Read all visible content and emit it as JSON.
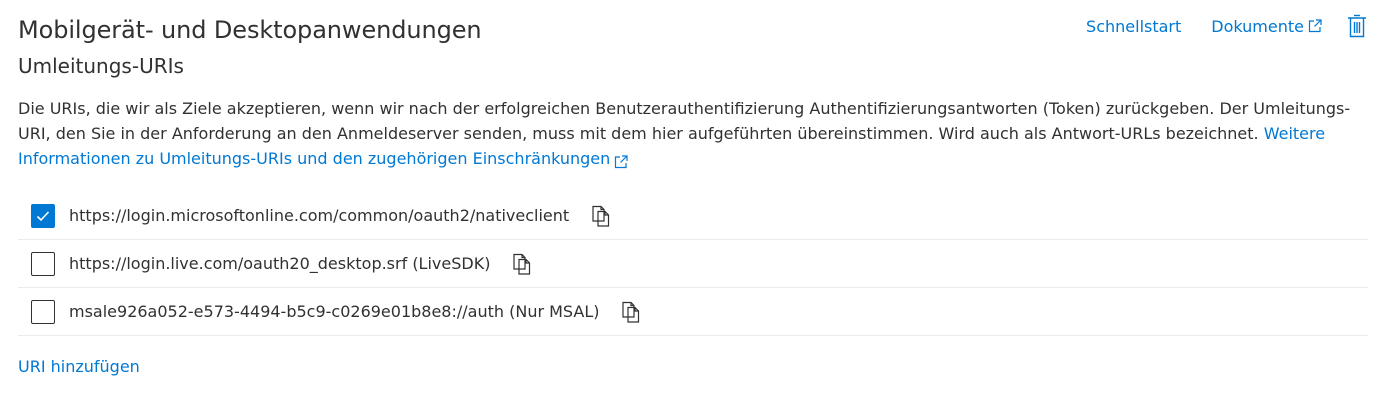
{
  "section": {
    "title": "Mobilgerät- und Desktopanwendungen",
    "subtitle": "Umleitungs-URIs"
  },
  "header_actions": {
    "quickstart_label": "Schnellstart",
    "docs_label": "Dokumente",
    "docs_icon": "external-link-icon",
    "delete_icon": "trash-icon"
  },
  "description": {
    "text": "Die URIs, die wir als Ziele akzeptieren, wenn wir nach der erfolgreichen Benutzerauthentifizierung Authentifizierungsantworten (Token) zurückgeben. Der Umleitungs-URI, den Sie in der Anforderung an den Anmeldeserver senden, muss mit dem hier aufgeführten übereinstimmen. Wird auch als Antwort-URLs bezeichnet. ",
    "link_label": "Weitere Informationen zu Umleitungs-URIs und den zugehörigen Einschränkungen"
  },
  "redirect_uris": [
    {
      "uri": "https://login.microsoftonline.com/common/oauth2/nativeclient",
      "checked": true
    },
    {
      "uri": "https://login.live.com/oauth20_desktop.srf (LiveSDK)",
      "checked": false
    },
    {
      "uri": "msale926a052-e573-4494-b5c9-c0269e01b8e8://auth (Nur MSAL)",
      "checked": false
    }
  ],
  "add_uri_label": "URI hinzufügen",
  "colors": {
    "accent": "#0078d4",
    "text": "#323130",
    "divider": "#edebe9"
  }
}
